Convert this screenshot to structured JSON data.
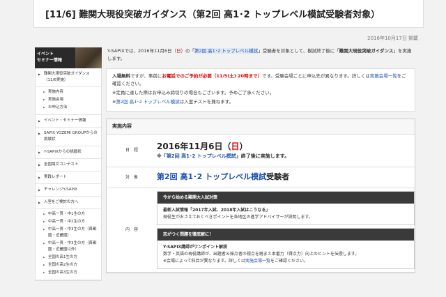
{
  "page": {
    "title": "[11/6] 難関大現役突破ガイダンス（第2回 高1･2 トップレベル模試受験者対象）",
    "date": "2016年10月17日 掲載"
  },
  "sidebar": {
    "banner": "イベント\nセミナー情報",
    "items": [
      {
        "label": "難関大現役突破ガイダンス（11/6実施）",
        "subs": [
          "実施内容",
          "実施会場",
          "お申込方法"
        ]
      },
      {
        "label": "イベント・セミナー情報"
      },
      {
        "label": "SAPIX YOZEMI GROUPからの挑戦状"
      },
      {
        "label": "Y-SAPIXからの挑戦状"
      },
      {
        "label": "全国論文コンテスト"
      },
      {
        "label": "実践レポート"
      },
      {
        "label": "チャレンジY-SAPIX"
      },
      {
        "label": "入室をご検討の方へ",
        "subs": [
          "中高一貫・中1生の方",
          "中高一貫・中2生の方",
          "中高一貫・中3生の方（首都圏・近畿圏）",
          "中高一貫・中3生の方（首都圏・近畿圏以外）",
          "全国の高1生の方",
          "全国の高2生の方",
          "全国の高3生の方"
        ]
      }
    ]
  },
  "intro": {
    "part1": "Y-SAPIXでは、2016年11月6日（",
    "day": "日",
    "part2": "）の「",
    "exam": "第2回 高1･2 トップレベル模試",
    "part3": "」受験者を対象として、模試終了後に「",
    "event": "難関大現役突破ガイダンス",
    "part4": "」を実施します。"
  },
  "notes": {
    "line1_a": "入場無料",
    "line1_b": "ですが、事前に",
    "line1_c": "お電話でのご予約が必要（11/5(土) 20時まで）",
    "line1_d": "です。受験会場ごとに申込先が異なります。詳しくは",
    "line1_e": "実施会場一覧",
    "line1_f": "をご確認ください。",
    "line2": "※定員に達した際はお申込み締切りの場合もございます。予めご了承ください。",
    "line3_a": "※",
    "line3_b": "第2回 高1･2 トップレベル模試",
    "line3_c": "は入室テストを兼ねます。"
  },
  "section": {
    "heading": "実施内容",
    "rows": {
      "date_label": "日　程",
      "date_main": "2016年11月6日（",
      "date_day": "日",
      "date_close": "）",
      "date_note_a": "※「",
      "date_note_b": "第2回 高1･2 トップレベル模試",
      "date_note_c": "」終了後に実施します。",
      "target_label": "対　象",
      "target_exam": "第2回 高1･2 トップレベル模試",
      "target_suffix": "受験者",
      "content_label": "内　容"
    },
    "box1": {
      "head": "今から始める難関大入試対策",
      "line1": "最新入試情報「2017年入試、2018年入試はこうなる」",
      "line2": "現役生がおさえておくべきポイントを各地区の進学アドバイザーが説明します。"
    },
    "box2": {
      "head": "志がつく問題を徹底解に！",
      "line1": "Y-SAPIX講師がワンポイント解説",
      "line2": "数学・英語の現役講師が、出題者＆採点者の視点を踏まえ本番力（得点力）向上のヒントを伝授します。",
      "line3_a": "※会場によって科目が異なります。詳しくは",
      "line3_b": "実施会場一覧",
      "line3_c": "をご確認ください。"
    }
  }
}
